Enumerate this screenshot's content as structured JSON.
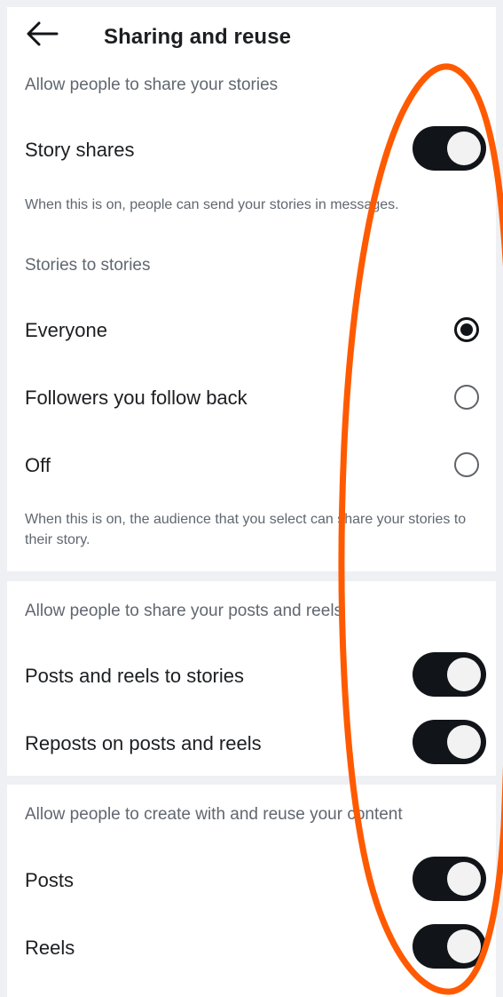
{
  "header": {
    "title": "Sharing and reuse",
    "back_icon": "arrow-left-icon"
  },
  "story_section": {
    "header": "Allow people to share your stories",
    "story_shares": {
      "label": "Story shares",
      "on": true
    },
    "story_shares_note": "When this is on, people can send your stories in messages.",
    "stories_to_stories_header": "Stories to stories",
    "options": [
      {
        "label": "Everyone",
        "selected": true
      },
      {
        "label": "Followers you follow back",
        "selected": false
      },
      {
        "label": "Off",
        "selected": false
      }
    ],
    "audience_note": "When this is on, the audience that you select can share your stories to their story."
  },
  "posts_section": {
    "header": "Allow people to share your posts and reels",
    "items": [
      {
        "label": "Posts and reels to stories",
        "on": true
      },
      {
        "label": "Reposts on posts and reels",
        "on": true
      }
    ]
  },
  "create_section": {
    "header": "Allow people to create with and reuse your content",
    "items": [
      {
        "label": "Posts",
        "on": true
      },
      {
        "label": "Reels",
        "on": true
      }
    ]
  },
  "colors": {
    "toggle_on": "#111418",
    "annotation": "#ff5a00",
    "secondary_text": "#606770"
  }
}
